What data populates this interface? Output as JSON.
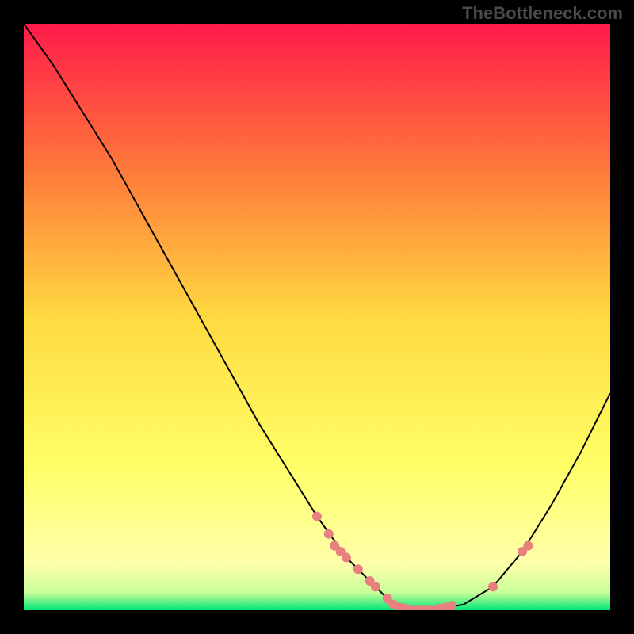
{
  "watermark": "TheBottleneck.com",
  "chart_data": {
    "type": "line",
    "title": "",
    "xlabel": "",
    "ylabel": "",
    "xlim": [
      0,
      100
    ],
    "ylim": [
      0,
      100
    ],
    "gradient_stops": [
      {
        "offset": 0,
        "color": "#ff1a4a"
      },
      {
        "offset": 25,
        "color": "#ff7a3a"
      },
      {
        "offset": 50,
        "color": "#ffd940"
      },
      {
        "offset": 75,
        "color": "#ffff66"
      },
      {
        "offset": 92,
        "color": "#ffffaa"
      },
      {
        "offset": 97,
        "color": "#c8ff99"
      },
      {
        "offset": 100,
        "color": "#00e676"
      }
    ],
    "series": [
      {
        "name": "bottleneck-curve",
        "x": [
          0,
          5,
          10,
          15,
          20,
          25,
          30,
          35,
          40,
          45,
          50,
          55,
          60,
          63,
          66,
          70,
          75,
          80,
          85,
          90,
          95,
          100
        ],
        "y": [
          100,
          93,
          85,
          77,
          68,
          59,
          50,
          41,
          32,
          24,
          16,
          9,
          4,
          1,
          0,
          0,
          1,
          4,
          10,
          18,
          27,
          37
        ]
      }
    ],
    "markers": [
      {
        "x": 50,
        "y": 16
      },
      {
        "x": 52,
        "y": 13
      },
      {
        "x": 53,
        "y": 11
      },
      {
        "x": 54,
        "y": 10
      },
      {
        "x": 55,
        "y": 9
      },
      {
        "x": 57,
        "y": 7
      },
      {
        "x": 59,
        "y": 5
      },
      {
        "x": 60,
        "y": 4
      },
      {
        "x": 62,
        "y": 2
      },
      {
        "x": 63,
        "y": 1
      },
      {
        "x": 64,
        "y": 0.5
      },
      {
        "x": 65,
        "y": 0.3
      },
      {
        "x": 66,
        "y": 0
      },
      {
        "x": 67,
        "y": 0
      },
      {
        "x": 68,
        "y": 0
      },
      {
        "x": 69,
        "y": 0
      },
      {
        "x": 70,
        "y": 0
      },
      {
        "x": 71,
        "y": 0.3
      },
      {
        "x": 72,
        "y": 0.5
      },
      {
        "x": 73,
        "y": 0.8
      },
      {
        "x": 80,
        "y": 4
      },
      {
        "x": 85,
        "y": 10
      },
      {
        "x": 86,
        "y": 11
      }
    ],
    "marker_color": "#e88080",
    "curve_color": "#000000"
  }
}
